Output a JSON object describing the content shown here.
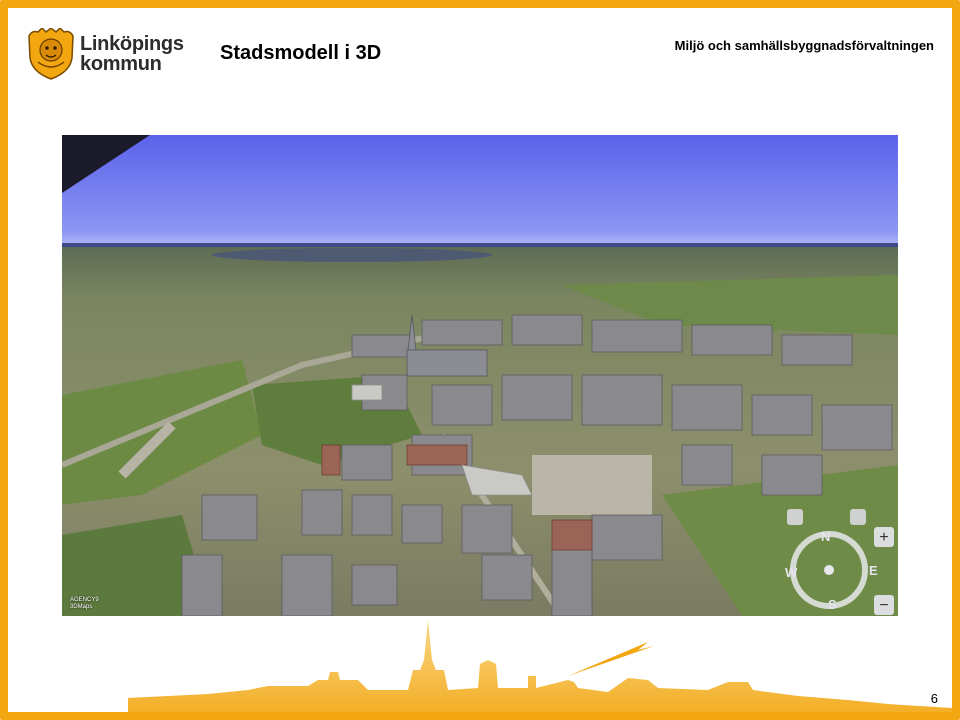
{
  "logo": {
    "line1": "Linköpings",
    "line2": "kommun"
  },
  "slide": {
    "title": "Stadsmodell i 3D",
    "page_number": "6"
  },
  "header": {
    "department": "Miljö och samhällsbyggnadsförvaltningen"
  },
  "map": {
    "watermark_line1": "AGENCY9",
    "watermark_line2": "3DMaps",
    "compass": {
      "n": "N",
      "s": "S",
      "e": "E",
      "w": "W"
    }
  },
  "colors": {
    "accent": "#f2a60f",
    "sky": "#6f7ef0",
    "building": "#8a8a8e"
  }
}
